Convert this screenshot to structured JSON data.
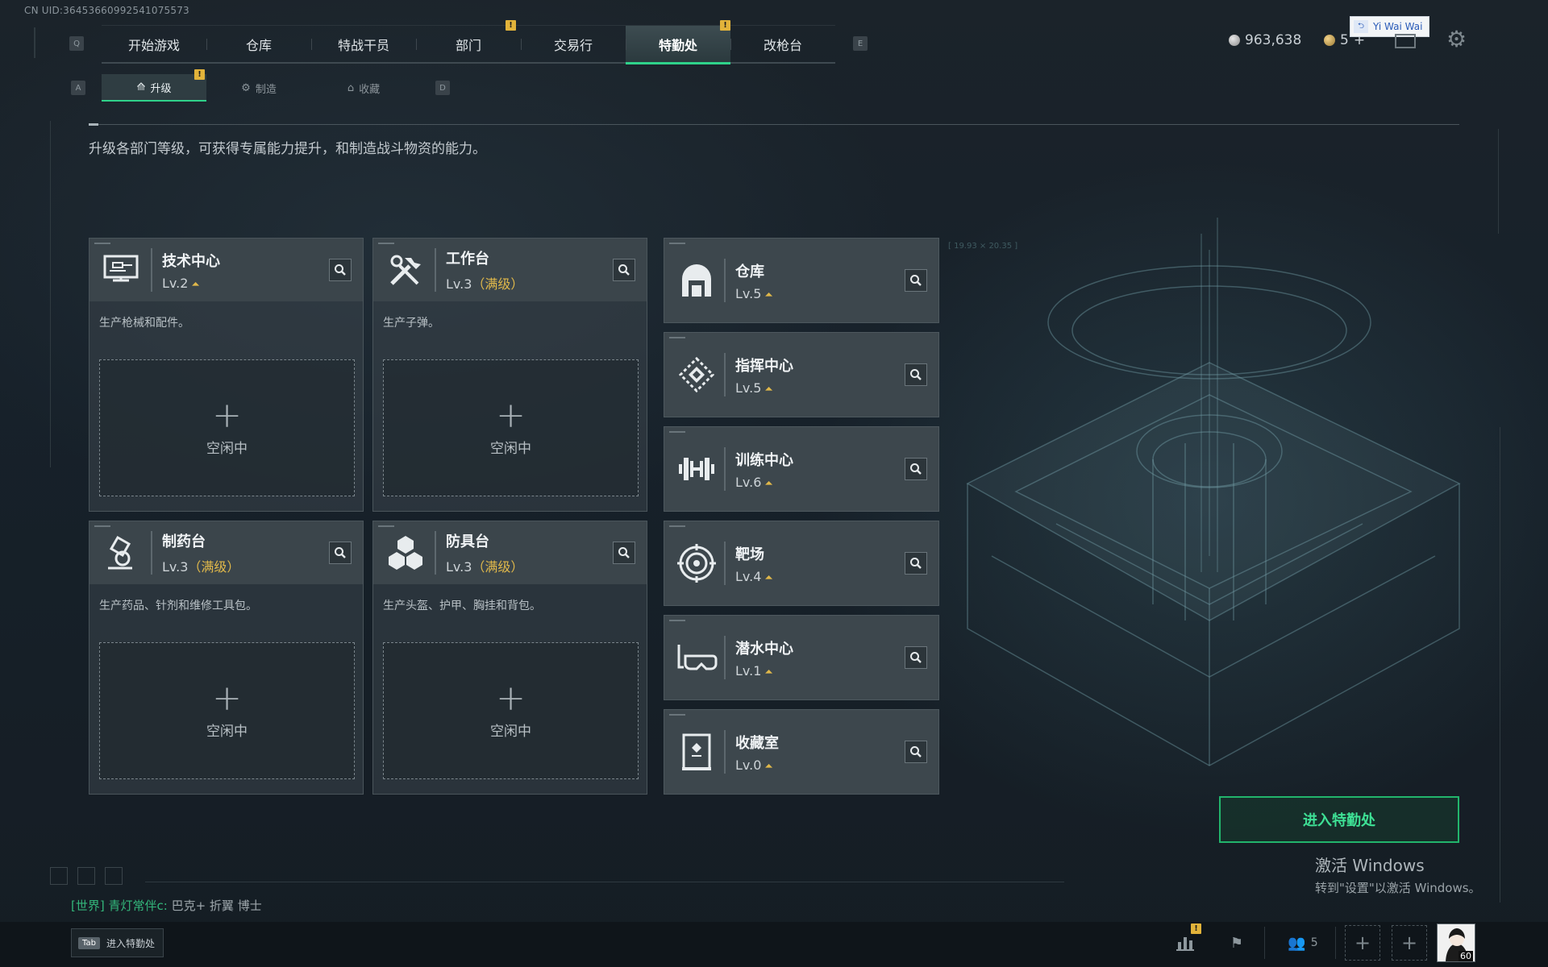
{
  "uid": "CN UID:36453660992541075573",
  "nav": {
    "prev_key": "Q",
    "next_key": "E",
    "tabs": [
      {
        "label": "开始游戏"
      },
      {
        "label": "仓库"
      },
      {
        "label": "特战干员"
      },
      {
        "label": "部门",
        "alert": "!"
      },
      {
        "label": "交易行"
      },
      {
        "label": "特勤处",
        "alert": "!",
        "active": true
      },
      {
        "label": "改枪台"
      }
    ]
  },
  "subnav": {
    "prev_key": "A",
    "next_key": "D",
    "tabs": [
      {
        "label": "升级",
        "alert": "!",
        "active": true
      },
      {
        "label": "制造"
      },
      {
        "label": "收藏"
      }
    ]
  },
  "header": {
    "silver": "963,638",
    "gold": "5",
    "gold_add": "+",
    "tooltip": "Yi Wai Wai"
  },
  "description": "升级各部门等级，可获得专属能力提升，和制造战斗物资的能力。",
  "production": [
    {
      "name": "技术中心",
      "level": "Lv.2",
      "max": "",
      "desc": "生产枪械和配件。",
      "slot": "空闲中",
      "icon": "tech-center-icon"
    },
    {
      "name": "工作台",
      "level": "Lv.3",
      "max": "（满级）",
      "desc": "生产子弹。",
      "slot": "空闲中",
      "icon": "workbench-icon"
    },
    {
      "name": "制药台",
      "level": "Lv.3",
      "max": "（满级）",
      "desc": "生产药品、针剂和维修工具包。",
      "slot": "空闲中",
      "icon": "pharmacy-icon"
    },
    {
      "name": "防具台",
      "level": "Lv.3",
      "max": "（满级）",
      "desc": "生产头盔、护甲、胸挂和背包。",
      "slot": "空闲中",
      "icon": "armor-bench-icon"
    }
  ],
  "facilities": [
    {
      "name": "仓库",
      "level": "Lv.5",
      "icon": "warehouse-icon"
    },
    {
      "name": "指挥中心",
      "level": "Lv.5",
      "icon": "command-center-icon"
    },
    {
      "name": "训练中心",
      "level": "Lv.6",
      "icon": "training-center-icon"
    },
    {
      "name": "靶场",
      "level": "Lv.4",
      "icon": "shooting-range-icon"
    },
    {
      "name": "潜水中心",
      "level": "Lv.1",
      "icon": "diving-center-icon"
    },
    {
      "name": "收藏室",
      "level": "Lv.0",
      "icon": "collection-room-icon"
    }
  ],
  "enter_button": "进入特勤处",
  "activation": {
    "line1": "激活 Windows",
    "line2": "转到\"设置\"以激活 Windows。"
  },
  "chat": {
    "channel": "[世界]",
    "sender": "青灯常伴c:",
    "message": "巴克+ 折翼  博士"
  },
  "bottom": {
    "tab_key": "Tab",
    "tab_label": "进入特勤处",
    "friends_count": "5",
    "stats_alert": "!",
    "avatar_level": "60"
  },
  "colors": {
    "accent_green": "#2fd28a",
    "alert_yellow": "#e2b33a",
    "max_level_gold": "#e0b84a"
  }
}
